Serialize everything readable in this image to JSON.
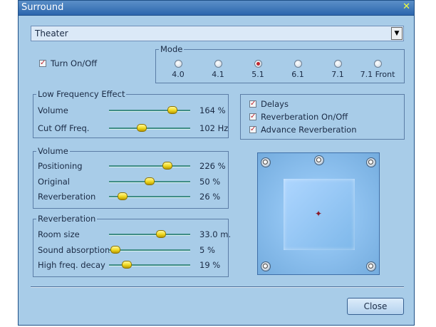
{
  "window": {
    "title": "Surround"
  },
  "preset": {
    "value": "Theater"
  },
  "turn_on_off": {
    "label": "Turn On/Off",
    "checked": true
  },
  "mode": {
    "legend": "Mode",
    "options": [
      "4.0",
      "4.1",
      "5.1",
      "6.1",
      "7.1",
      "7.1 Front"
    ],
    "selected": "5.1"
  },
  "lfe": {
    "legend": "Low Frequency Effect",
    "sliders": [
      {
        "label": "Volume",
        "value": "164 %",
        "level": 0.78
      },
      {
        "label": "Cut Off Freq.",
        "value": "102 Hz",
        "level": 0.4
      }
    ]
  },
  "effects": {
    "delays": {
      "label": "Delays",
      "checked": true
    },
    "reverb_on_off": {
      "label": "Reverberation On/Off",
      "checked": true
    },
    "advance_reverb": {
      "label": "Advance Reverberation",
      "checked": true
    }
  },
  "volume": {
    "legend": "Volume",
    "sliders": [
      {
        "label": "Positioning",
        "value": "226 %",
        "level": 0.72
      },
      {
        "label": "Original",
        "value": "50 %",
        "level": 0.5
      },
      {
        "label": "Reverberation",
        "value": "26 %",
        "level": 0.17
      }
    ]
  },
  "reverberation": {
    "legend": "Reverberation",
    "sliders": [
      {
        "label": "Room size",
        "value": "33.0 m.",
        "level": 0.64
      },
      {
        "label": "Sound absorption",
        "value": "5 %",
        "level": 0.08
      },
      {
        "label": "High freq. decay",
        "value": "19 %",
        "level": 0.22
      }
    ]
  },
  "close_label": "Close",
  "colors": {
    "title_bar": "#2c66ad",
    "dialog_bg": "#a8cce8",
    "slider_track": "#3f8d86",
    "check_mark": "#c0262d"
  }
}
